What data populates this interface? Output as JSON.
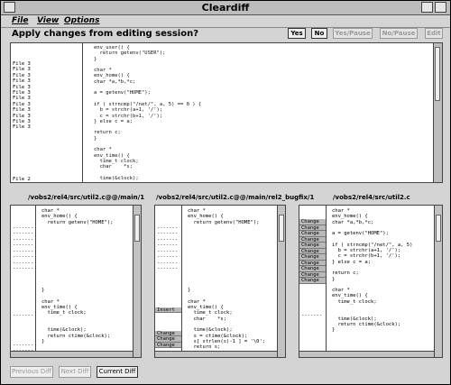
{
  "window": {
    "title": "Cleardiff"
  },
  "menu": {
    "items": [
      "File",
      "View",
      "Options"
    ]
  },
  "prompt": {
    "question": "Apply changes from editing session?",
    "buttons": {
      "yes": "Yes",
      "no": "No",
      "yes_pause": "Yes/Pause",
      "no_pause": "No/Pause",
      "edit": "Edit"
    }
  },
  "top_pane": {
    "file_labels": [
      "File 3",
      "File 3",
      "File 3",
      "File 3",
      "File 3",
      "File 3",
      "File 3",
      "File 3",
      "File 3",
      "File 3",
      "File 3",
      "File 3",
      "",
      "",
      "",
      "",
      "",
      "",
      "",
      "",
      "File 2"
    ],
    "code": "env_user() {\n  return getenv(\"USER\");\n}\n\nchar *\nenv_home() {\nchar *a,*b,*c;\n\na = getenv(\"HOME\");\n\nif ( strncmp(\"/net/\", a, 5) == 0 ) {\n  b = strchr(a+1, '/');\n  c = strchr(b+1, '/');\n} else c = a;\n\nreturn c;\n}\n\nchar *\nenv_time() {\n  time_t clock;\n  char    *s;\n\n  time(&clock);"
  },
  "panes": [
    {
      "title": "/vobs2/rel4/src/util2.c@@/main/1",
      "markers": [
        "",
        "",
        "",
        "-------",
        "-------",
        "-------",
        "-------",
        "-------",
        "-------",
        "-------",
        "-------",
        "",
        "",
        "",
        "",
        "",
        "",
        "",
        "-------",
        "",
        "",
        "",
        "",
        "-------",
        "-------"
      ],
      "code": "char *\nenv_home() {\n  return getenv(\"HOME\");\n\n\n\n\n\n\n\n\n\n\n\n}\n\nchar *\nenv_time() {\n  time_t clock;\n\n\n  time(&clock);\n  return ctime(&clock);\n}"
    },
    {
      "title": "/vobs2/rel4/src/util2.c@@/main/rel2_bugfix/1",
      "markers": [
        "",
        "",
        "",
        "-------",
        "-------",
        "-------",
        "-------",
        "-------",
        "-------",
        "-------",
        "-------",
        "",
        "",
        "",
        "",
        "",
        "",
        "Insert",
        "",
        "",
        "",
        "Change",
        "Change",
        "Change"
      ],
      "code": "char *\nenv_home() {\n  return getenv(\"HOME\");\n\n\n\n\n\n\n\n\n\n\n\n}\n\nchar *\nenv_time() {\n  time_t clock;\n  char    *s;\n\n  time(&clock);\n  s = ctime(&clock);\n  s[ strlen(s)-1 ] = '\\0';\n  return s;"
    },
    {
      "title": "/vobs2/rel4/src/util2.c",
      "markers": [
        "",
        "",
        "Change",
        "Change",
        "Change",
        "Change",
        "Change",
        "Change",
        "Change",
        "Change",
        "Change",
        "Change",
        "Change",
        "",
        "",
        "",
        "",
        "",
        "-------",
        "",
        "",
        "",
        "",
        ""
      ],
      "code": "char *\nenv_home() {\nchar *a,*b,*c;\n\na = getenv(\"HOME\");\n\nif ( strncmp(\"/net/\", a, 5)\n  b = strchr(a+1, '/');\n  c = strchr(b+1, '/');\n} else c = a;\n\nreturn c;\n}\n\nchar *\nenv_time() {\n  time_t clock;\n\n\n  time(&clock);\n  return ctime(&clock);\n}"
    }
  ],
  "bottom": {
    "prev": "Previous Diff",
    "next": "Next Diff",
    "current": "Current Diff"
  }
}
